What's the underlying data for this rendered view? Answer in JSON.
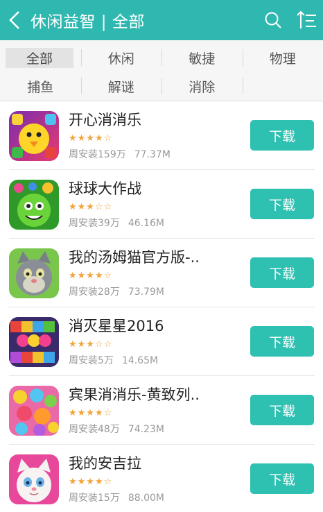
{
  "header": {
    "title": "休闲益智 | 全部",
    "back_icon": "back-arrow-icon",
    "search_icon": "search-icon",
    "sort_icon": "sort-icon"
  },
  "categories": [
    [
      "全部",
      "休闲",
      "敏捷",
      "物理"
    ],
    [
      "捕鱼",
      "解谜",
      "消除"
    ]
  ],
  "active_category": "全部",
  "apps": [
    {
      "name": "开心消消乐",
      "rating": 3.5,
      "stars": "★★★★☆",
      "installs": "周安装159万",
      "size": "77.37M",
      "button": "下载"
    },
    {
      "name": "球球大作战",
      "rating": 3,
      "stars": "★★★☆☆",
      "installs": "周安装39万",
      "size": "46.16M",
      "button": "下载"
    },
    {
      "name": "我的汤姆猫官方版-..",
      "rating": 4,
      "stars": "★★★★☆",
      "installs": "周安装28万",
      "size": "73.79M",
      "button": "下载"
    },
    {
      "name": "消灭星星2016",
      "rating": 3,
      "stars": "★★★☆☆",
      "installs": "周安装5万",
      "size": "14.65M",
      "button": "下载"
    },
    {
      "name": "宾果消消乐-黄致列..",
      "rating": 4,
      "stars": "★★★★☆",
      "installs": "周安装48万",
      "size": "74.23M",
      "button": "下载"
    },
    {
      "name": "我的安吉拉",
      "rating": 4,
      "stars": "★★★★☆",
      "installs": "周安装15万",
      "size": "88.00M",
      "button": "下载"
    }
  ],
  "colors": {
    "accent": "#2eb8b0",
    "button": "#2ec0b0",
    "star": "#f2a33a"
  }
}
